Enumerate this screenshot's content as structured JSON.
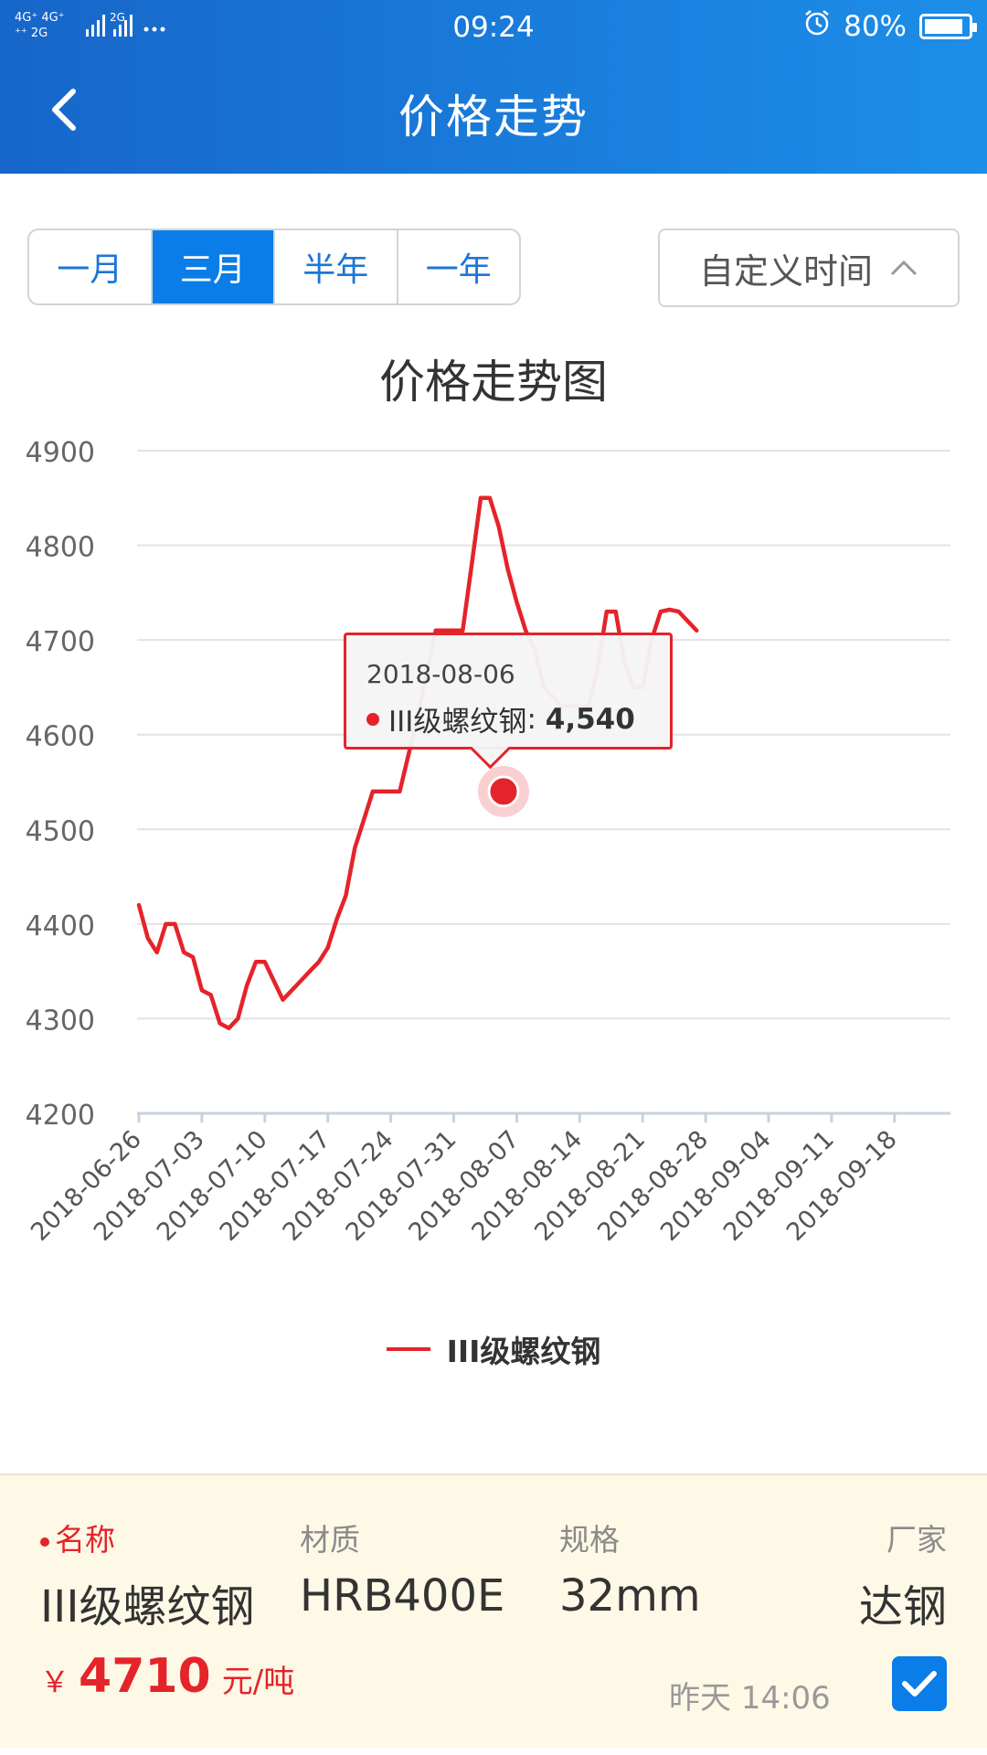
{
  "status_bar": {
    "network": "4G⁺ 4G⁺ 2G 2G",
    "time": "09:24",
    "battery": "80%"
  },
  "header": {
    "title": "价格走势"
  },
  "filters": {
    "ranges": [
      "一月",
      "三月",
      "半年",
      "一年"
    ],
    "active_index": 1,
    "custom_label": "自定义时间"
  },
  "chart_data": {
    "type": "line",
    "title": "价格走势图",
    "xlabel": "",
    "ylabel": "",
    "ylim": [
      4200,
      4900
    ],
    "yticks": [
      4200,
      4300,
      4400,
      4500,
      4600,
      4700,
      4800,
      4900
    ],
    "xticks": [
      "2018-06-26",
      "2018-07-03",
      "2018-07-10",
      "2018-07-17",
      "2018-07-24",
      "2018-07-31",
      "2018-08-07",
      "2018-08-14",
      "2018-08-21",
      "2018-08-28",
      "2018-09-04",
      "2018-09-11",
      "2018-09-18"
    ],
    "grid": true,
    "legend_position": "bottom",
    "series": [
      {
        "name": "III级螺纹钢",
        "color": "#e5232a",
        "points": [
          [
            "2018-06-26",
            4420
          ],
          [
            "2018-06-27",
            4385
          ],
          [
            "2018-06-28",
            4370
          ],
          [
            "2018-06-29",
            4400
          ],
          [
            "2018-06-30",
            4400
          ],
          [
            "2018-07-01",
            4370
          ],
          [
            "2018-07-02",
            4365
          ],
          [
            "2018-07-03",
            4330
          ],
          [
            "2018-07-04",
            4325
          ],
          [
            "2018-07-05",
            4295
          ],
          [
            "2018-07-06",
            4290
          ],
          [
            "2018-07-07",
            4300
          ],
          [
            "2018-07-08",
            4335
          ],
          [
            "2018-07-09",
            4360
          ],
          [
            "2018-07-10",
            4360
          ],
          [
            "2018-07-11",
            4340
          ],
          [
            "2018-07-12",
            4320
          ],
          [
            "2018-07-13",
            4330
          ],
          [
            "2018-07-14",
            4340
          ],
          [
            "2018-07-15",
            4350
          ],
          [
            "2018-07-16",
            4360
          ],
          [
            "2018-07-17",
            4375
          ],
          [
            "2018-07-18",
            4405
          ],
          [
            "2018-07-19",
            4430
          ],
          [
            "2018-07-20",
            4480
          ],
          [
            "2018-07-21",
            4510
          ],
          [
            "2018-07-22",
            4540
          ],
          [
            "2018-07-23",
            4540
          ],
          [
            "2018-07-24",
            4540
          ],
          [
            "2018-07-25",
            4540
          ],
          [
            "2018-07-26",
            4580
          ],
          [
            "2018-07-27",
            4620
          ],
          [
            "2018-07-28",
            4665
          ],
          [
            "2018-07-29",
            4710
          ],
          [
            "2018-07-30",
            4710
          ],
          [
            "2018-07-31",
            4710
          ],
          [
            "2018-08-01",
            4710
          ],
          [
            "2018-08-02",
            4780
          ],
          [
            "2018-08-03",
            4850
          ],
          [
            "2018-08-04",
            4850
          ],
          [
            "2018-08-05",
            4820
          ],
          [
            "2018-08-06",
            4775
          ],
          [
            "2018-08-07",
            4740
          ],
          [
            "2018-08-08",
            4710
          ],
          [
            "2018-08-09",
            4690
          ],
          [
            "2018-08-10",
            4650
          ],
          [
            "2018-08-11",
            4640
          ],
          [
            "2018-08-12",
            4630
          ],
          [
            "2018-08-13",
            4630
          ],
          [
            "2018-08-14",
            4630
          ],
          [
            "2018-08-15",
            4630
          ],
          [
            "2018-08-16",
            4670
          ],
          [
            "2018-08-17",
            4730
          ],
          [
            "2018-08-18",
            4730
          ],
          [
            "2018-08-19",
            4675
          ],
          [
            "2018-08-20",
            4650
          ],
          [
            "2018-08-21",
            4650
          ],
          [
            "2018-08-22",
            4700
          ],
          [
            "2018-08-23",
            4730
          ],
          [
            "2018-08-24",
            4732
          ],
          [
            "2018-08-25",
            4730
          ],
          [
            "2018-08-26",
            4720
          ],
          [
            "2018-08-27",
            4710
          ]
        ]
      }
    ],
    "tooltip": {
      "date": "2018-08-06",
      "series_name": "III级螺纹钢",
      "value": "4,540",
      "y": 4540
    }
  },
  "info_card": {
    "labels": {
      "name": "名称",
      "material": "材质",
      "spec": "规格",
      "factory": "厂家"
    },
    "values": {
      "name": "III级螺纹钢",
      "material": "HRB400E",
      "spec": "32mm",
      "factory": "达钢"
    },
    "price": {
      "currency": "￥",
      "value": "4710",
      "unit": "元/吨"
    },
    "update_time": "昨天 14:06",
    "checked": true
  },
  "colors": {
    "header": "#1a82e0",
    "accent": "#0b7de8",
    "line": "#e5232a"
  }
}
